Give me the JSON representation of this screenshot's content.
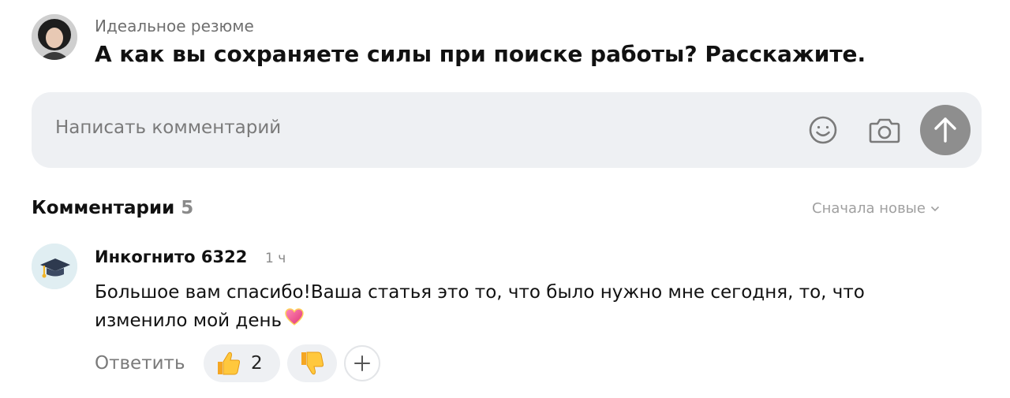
{
  "post": {
    "author": "Идеальное резюме",
    "question": "А как вы сохраняете силы при поиске работы? Расскажите."
  },
  "composer": {
    "placeholder": "Написать комментарий",
    "icons": [
      "smile-icon",
      "camera-icon",
      "arrow-up-icon"
    ]
  },
  "comments_section": {
    "title": "Комментарии",
    "count": "5",
    "sort_label": "Сначала новые"
  },
  "comments": [
    {
      "author": "Инкогнито 6322",
      "time": "1 ч",
      "text": "Большое вам спасибо!Ваша статья это то, что было нужно мне сегодня, то, что изменило мой день",
      "reply_label": "Ответить",
      "likes": "2"
    }
  ],
  "colors": {
    "background": "#ffffff",
    "input_bg": "#eef0f3",
    "send_button": "#8e8e8e",
    "muted_text": "#7a7a7a"
  }
}
